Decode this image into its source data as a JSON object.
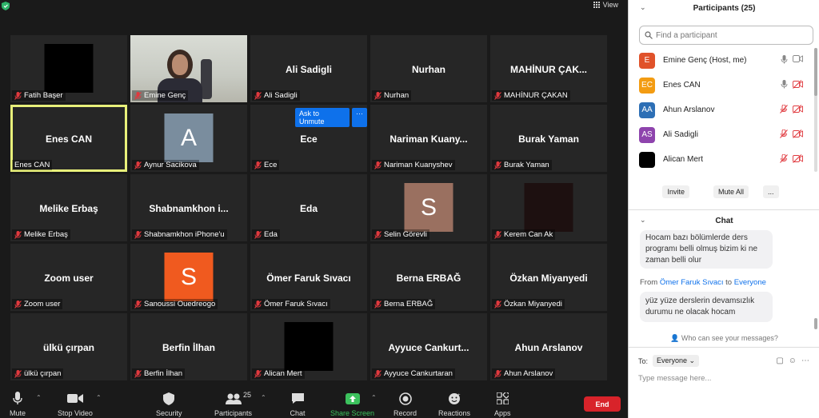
{
  "toolbar_top": {
    "view_label": "View"
  },
  "tiles": [
    {
      "type": "black",
      "center": "",
      "caption": "Fatih Başer"
    },
    {
      "type": "photo",
      "center": "",
      "caption": "Emine Genç"
    },
    {
      "type": "name",
      "center": "Ali Sadigli",
      "caption": "Ali Sadigli"
    },
    {
      "type": "name",
      "center": "Nurhan",
      "caption": "Nurhan"
    },
    {
      "type": "name",
      "center": "MAHİNUR  ÇAK...",
      "caption": "MAHİNUR ÇAKAN"
    },
    {
      "type": "name",
      "center": "Enes CAN",
      "caption": "Enes CAN",
      "active": true,
      "nomic": true
    },
    {
      "type": "avatar",
      "letter": "A",
      "color": "#7a8d9e",
      "center": "",
      "caption": "Aynur Sacikova"
    },
    {
      "type": "name",
      "center": "Ece",
      "caption": "Ece",
      "unmute": true
    },
    {
      "type": "name",
      "center": "Nariman  Kuany...",
      "caption": "Nariman Kuanyshev"
    },
    {
      "type": "name",
      "center": "Burak Yaman",
      "caption": "Burak Yaman"
    },
    {
      "type": "name",
      "center": "Melike Erbaş",
      "caption": "Melike Erbaş"
    },
    {
      "type": "name",
      "center": "Shabnamkhon  i...",
      "caption": "Shabnamkhon iPhone'u"
    },
    {
      "type": "name",
      "center": "Eda",
      "caption": "Eda"
    },
    {
      "type": "avatar",
      "letter": "S",
      "color": "#9a7060",
      "center": "",
      "caption": "Selin Görevli"
    },
    {
      "type": "darkbox",
      "center": "",
      "caption": "Kerem Can Ak"
    },
    {
      "type": "name",
      "center": "Zoom user",
      "caption": "Zoom user"
    },
    {
      "type": "avatar",
      "letter": "S",
      "color": "#f05a1f",
      "center": "",
      "caption": "Sanoussi Ouedreogo"
    },
    {
      "type": "name",
      "center": "Ömer Faruk Sıvacı",
      "caption": "Ömer Faruk Sıvacı"
    },
    {
      "type": "name",
      "center": "Berna ERBAĞ",
      "caption": "Berna ERBAĞ"
    },
    {
      "type": "name",
      "center": "Özkan Miyanyedi",
      "caption": "Özkan Miyanyedi"
    },
    {
      "type": "name",
      "center": "ülkü çırpan",
      "caption": "ülkü çırpan"
    },
    {
      "type": "name",
      "center": "Berfin İlhan",
      "caption": "Berfin İlhan"
    },
    {
      "type": "black",
      "center": "",
      "caption": "Alican Mert"
    },
    {
      "type": "name",
      "center": "Ayyuce  Cankurt...",
      "caption": "Ayyuce Cankurtaran"
    },
    {
      "type": "name",
      "center": "Ahun Arslanov",
      "caption": "Ahun Arslanov"
    }
  ],
  "unmute": {
    "ask_label": "Ask to Unmute",
    "more_label": "···"
  },
  "toolbar": {
    "mute": "Mute",
    "stop_video": "Stop Video",
    "security": "Security",
    "participants": "Participants",
    "participants_count": "25",
    "chat": "Chat",
    "share_screen": "Share Screen",
    "record": "Record",
    "reactions": "Reactions",
    "apps": "Apps",
    "end": "End"
  },
  "panel": {
    "participants_title": "Participants (25)",
    "search_placeholder": "Find a participant",
    "participants": [
      {
        "initials": "E",
        "color": "#e0522a",
        "name": "Emine Genç (Host, me)",
        "mic_on": true,
        "video_on": true
      },
      {
        "initials": "EC",
        "color": "#f39c12",
        "name": "Enes CAN",
        "mic_on": true,
        "video_on": false
      },
      {
        "initials": "AA",
        "color": "#2d6fb5",
        "name": "Ahun Arslanov",
        "mic_on": false,
        "video_on": false
      },
      {
        "initials": "AS",
        "color": "#8e44ad",
        "name": "Ali Sadigli",
        "mic_on": false,
        "video_on": false
      },
      {
        "initials": "",
        "color": "#000000",
        "name": "Alican Mert",
        "mic_on": false,
        "video_on": false
      }
    ],
    "invite": "Invite",
    "mute_all": "Mute All",
    "more": "...",
    "chat_title": "Chat",
    "msg1": "Hocam bazı bölümlerde ders programı belli olmuş bizim ki ne zaman belli olur",
    "from_prefix": "From",
    "from_name": "Ömer Faruk Sıvacı",
    "from_to": "to",
    "from_target": "Everyone",
    "msg2": "yüz yüze derslerin devamsızlık durumu ne olacak hocam",
    "who_can_see": "Who can see your messages?",
    "to_label": "To:",
    "to_value": "Everyone",
    "input_placeholder": "Type message here..."
  }
}
